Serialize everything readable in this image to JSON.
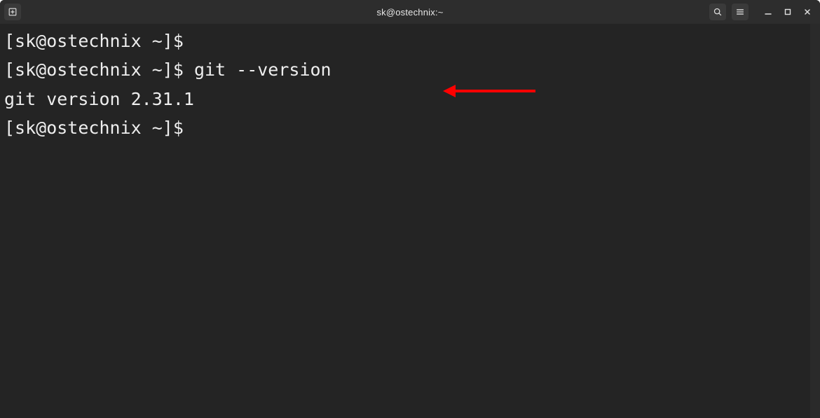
{
  "window": {
    "title": "sk@ostechnix:~"
  },
  "terminal": {
    "lines": [
      {
        "prompt": "[sk@ostechnix ~]$",
        "command": ""
      },
      {
        "prompt": "[sk@ostechnix ~]$",
        "command": "git --version"
      },
      {
        "output": "git version 2.31.1"
      },
      {
        "prompt": "[sk@ostechnix ~]$",
        "command": ""
      }
    ]
  },
  "icons": {
    "newtab": "new-tab",
    "search": "search",
    "menu": "hamburger",
    "minimize": "minimize",
    "maximize": "maximize",
    "close": "close"
  },
  "annotation": {
    "color": "#ff0000",
    "type": "arrow-left"
  }
}
